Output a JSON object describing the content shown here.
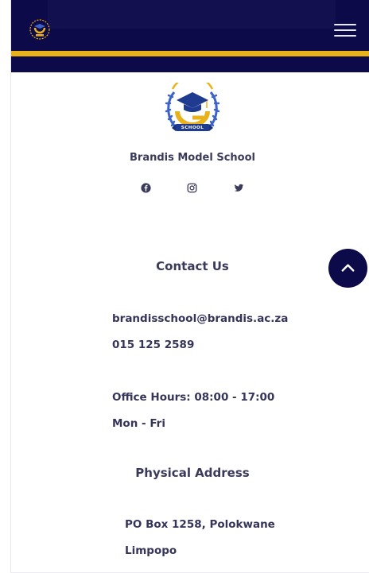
{
  "header": {
    "logo_icon": "school-crest-icon",
    "menu_icon": "hamburger-menu-icon",
    "colors": {
      "navy": "#0d0a4a",
      "gold": "#e9b21a"
    }
  },
  "footer": {
    "school_name": "Brandis Model School",
    "logo_text": "SCHOOL",
    "socials": [
      {
        "name": "facebook",
        "icon": "facebook-icon"
      },
      {
        "name": "instagram",
        "icon": "instagram-icon"
      },
      {
        "name": "twitter",
        "icon": "twitter-icon"
      }
    ],
    "contact": {
      "title": "Contact Us",
      "email": "brandisschool@brandis.ac.za",
      "phone": "015 125 2589",
      "hours": "Office Hours: 08:00 - 17:00",
      "days": "Mon - Fri"
    },
    "address": {
      "title": "Physical Address",
      "line1": "PO Box 1258, Polokwane",
      "line2": "Limpopo"
    }
  },
  "scroll_top_icon": "chevron-up-icon"
}
